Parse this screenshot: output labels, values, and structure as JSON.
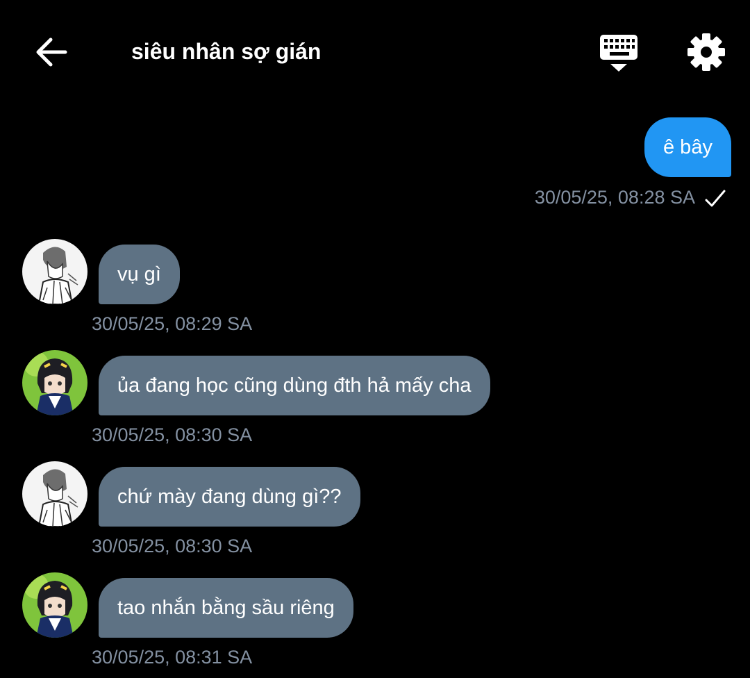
{
  "header": {
    "title": "siêu nhân sợ gián",
    "back_icon": "arrow-left-icon",
    "keyboard_icon": "keyboard-hide-icon",
    "settings_icon": "gear-icon"
  },
  "colors": {
    "background": "#000000",
    "outgoing_bubble": "#2196f3",
    "incoming_bubble": "#5e7284",
    "timestamp": "#8491a2"
  },
  "messages": [
    {
      "direction": "outgoing",
      "text": "ê bây",
      "time": "30/05/25, 08:28 SA",
      "status_icon": "check-icon"
    },
    {
      "direction": "incoming",
      "text": "vụ gì",
      "time": "30/05/25, 08:29 SA",
      "avatar": "sketch-avatar"
    },
    {
      "direction": "incoming",
      "text": "ủa đang học cũng dùng đth hả mấy cha",
      "time": "30/05/25, 08:30 SA",
      "avatar": "anime-avatar"
    },
    {
      "direction": "incoming",
      "text": "chứ mày đang dùng gì??",
      "time": "30/05/25, 08:30 SA",
      "avatar": "sketch-avatar"
    },
    {
      "direction": "incoming",
      "text": "tao nhắn bằng sầu riêng",
      "time": "30/05/25, 08:31 SA",
      "avatar": "anime-avatar"
    }
  ]
}
